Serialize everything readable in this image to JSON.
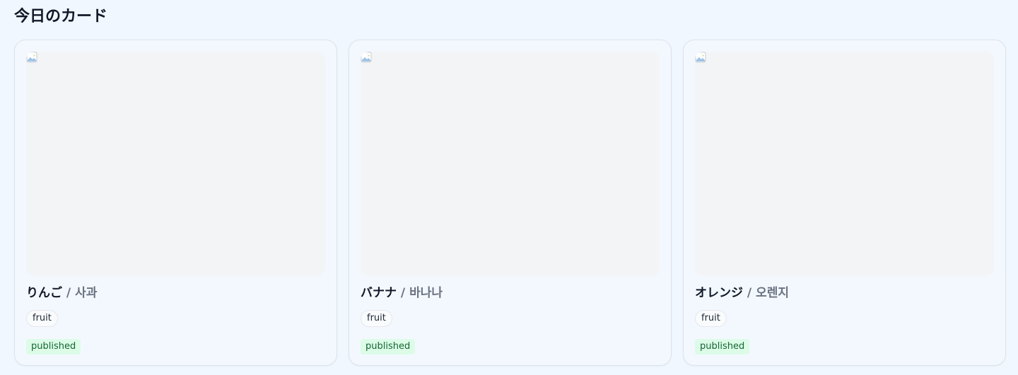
{
  "header": {
    "title": "今日のカード"
  },
  "colors": {
    "page_background": "#f0f7ff",
    "card_border": "#dde3ea",
    "image_placeholder": "#f3f4f6",
    "status_badge_bg": "#dcfce7",
    "status_badge_text": "#166534",
    "translation_text": "#6b7280"
  },
  "cards": [
    {
      "image_icon": "broken-image-icon",
      "title": "りんご",
      "separator": "/",
      "translation": "사과",
      "tag": "fruit",
      "status": "published"
    },
    {
      "image_icon": "broken-image-icon",
      "title": "バナナ",
      "separator": "/",
      "translation": "바나나",
      "tag": "fruit",
      "status": "published"
    },
    {
      "image_icon": "broken-image-icon",
      "title": "オレンジ",
      "separator": "/",
      "translation": "오렌지",
      "tag": "fruit",
      "status": "published"
    }
  ]
}
